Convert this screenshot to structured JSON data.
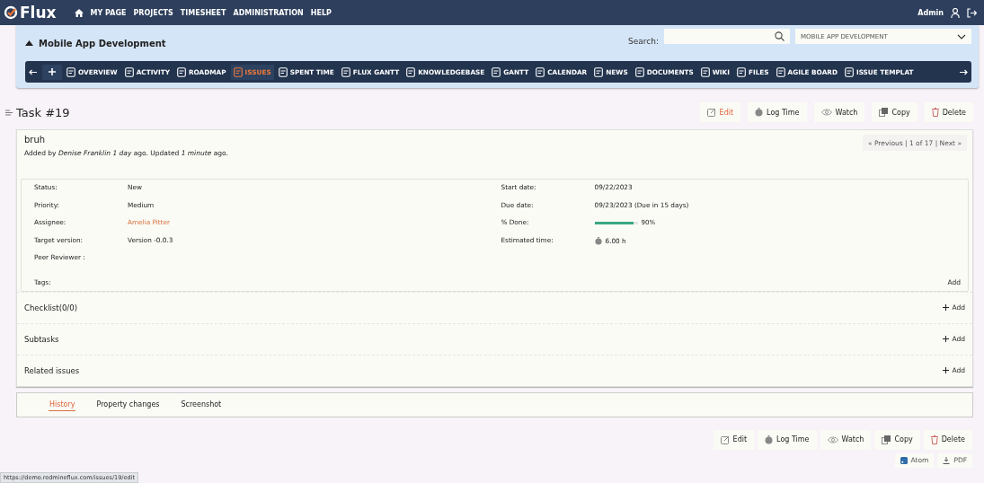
{
  "header": {
    "logo": "Flux",
    "menu": [
      "MY PAGE",
      "PROJECTS",
      "TIMESHEET",
      "ADMINISTRATION",
      "HELP"
    ],
    "user": "Admin"
  },
  "project": {
    "name": "Mobile App Development",
    "search_label": "Search:",
    "project_select": "MOBILE APP DEVELOPMENT"
  },
  "nav": [
    {
      "label": "OVERVIEW",
      "selected": false
    },
    {
      "label": "ACTIVITY",
      "selected": false
    },
    {
      "label": "ROADMAP",
      "selected": false
    },
    {
      "label": "ISSUES",
      "selected": true
    },
    {
      "label": "SPENT TIME",
      "selected": false
    },
    {
      "label": "FLUX GANTT",
      "selected": false
    },
    {
      "label": "KNOWLEDGEBASE",
      "selected": false
    },
    {
      "label": "GANTT",
      "selected": false
    },
    {
      "label": "CALENDAR",
      "selected": false
    },
    {
      "label": "NEWS",
      "selected": false
    },
    {
      "label": "DOCUMENTS",
      "selected": false
    },
    {
      "label": "WIKI",
      "selected": false
    },
    {
      "label": "FILES",
      "selected": false
    },
    {
      "label": "AGILE BOARD",
      "selected": false
    },
    {
      "label": "ISSUE TEMPLAT",
      "selected": false
    }
  ],
  "title": "Task #19",
  "actions_top": [
    {
      "label": "Edit",
      "hovered": true
    },
    {
      "label": "Log Time",
      "hovered": false
    },
    {
      "label": "Watch",
      "hovered": false
    },
    {
      "label": "Copy",
      "hovered": false
    },
    {
      "label": "Delete",
      "hovered": false
    }
  ],
  "issue": {
    "subject": "bruh",
    "byline": "Added by *Denise Franklin* *1 day* ago. Updated *1 minute* ago.",
    "pager": "« Previous | 1 of 17 | Next »"
  },
  "attributes_left": [
    {
      "kind": "text",
      "label": "Status:",
      "value": "New"
    },
    {
      "kind": "text",
      "label": "Priority:",
      "value": "Medium"
    },
    {
      "kind": "link",
      "label": "Assignee:",
      "value": "Amelia Pitter"
    },
    {
      "kind": "text",
      "label": "Target version:",
      "value": "Version -0.0.3"
    },
    {
      "kind": "empty",
      "label": "Peer Reviewer :"
    }
  ],
  "attributes_right": [
    {
      "kind": "text",
      "label": "Start date:",
      "value": "09/22/2023"
    },
    {
      "kind": "text",
      "label": "Due date:",
      "value": "09/23/2023 (Due in 15 days)"
    },
    {
      "kind": "progress",
      "label": "% Done:",
      "value": "90%",
      "level": 0.9
    },
    {
      "kind": "time",
      "label": "Estimated time:",
      "value": "6.00 h"
    }
  ],
  "tags": {
    "label": "Tags:",
    "add": "Add"
  },
  "sections": [
    {
      "title": "Checklist(0/0)",
      "add": "Add"
    },
    {
      "title": "Subtasks",
      "add": "Add"
    },
    {
      "title": "Related issues",
      "add": "Add"
    }
  ],
  "history_tabs": [
    {
      "label": "History",
      "selected": true
    },
    {
      "label": "Property changes",
      "selected": false
    },
    {
      "label": "Screenshot",
      "selected": false
    }
  ],
  "actions_bottom": [
    {
      "label": "Edit",
      "hovered": false
    },
    {
      "label": "Log Time",
      "hovered": false
    },
    {
      "label": "Watch",
      "hovered": false
    },
    {
      "label": "Copy",
      "hovered": false
    },
    {
      "label": "Delete",
      "hovered": false
    }
  ],
  "exports": [
    "Atom",
    "PDF"
  ],
  "status_url": "https://demo.redmineflux.com/issues/19/edit"
}
